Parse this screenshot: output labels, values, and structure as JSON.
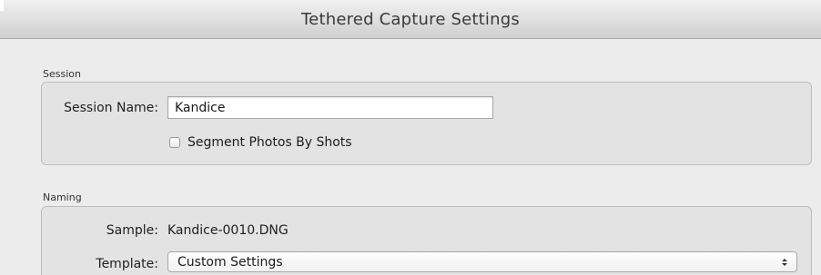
{
  "window": {
    "title": "Tethered Capture Settings"
  },
  "session": {
    "section_label": "Session",
    "name_label": "Session Name:",
    "name_value": "Kandice",
    "segment_label": "Segment Photos By Shots",
    "segment_checked": false
  },
  "naming": {
    "section_label": "Naming",
    "sample_label": "Sample:",
    "sample_value": "Kandice-0010.DNG",
    "template_label": "Template:",
    "template_value": "Custom Settings",
    "template_icon": "chevron-updown-icon"
  }
}
